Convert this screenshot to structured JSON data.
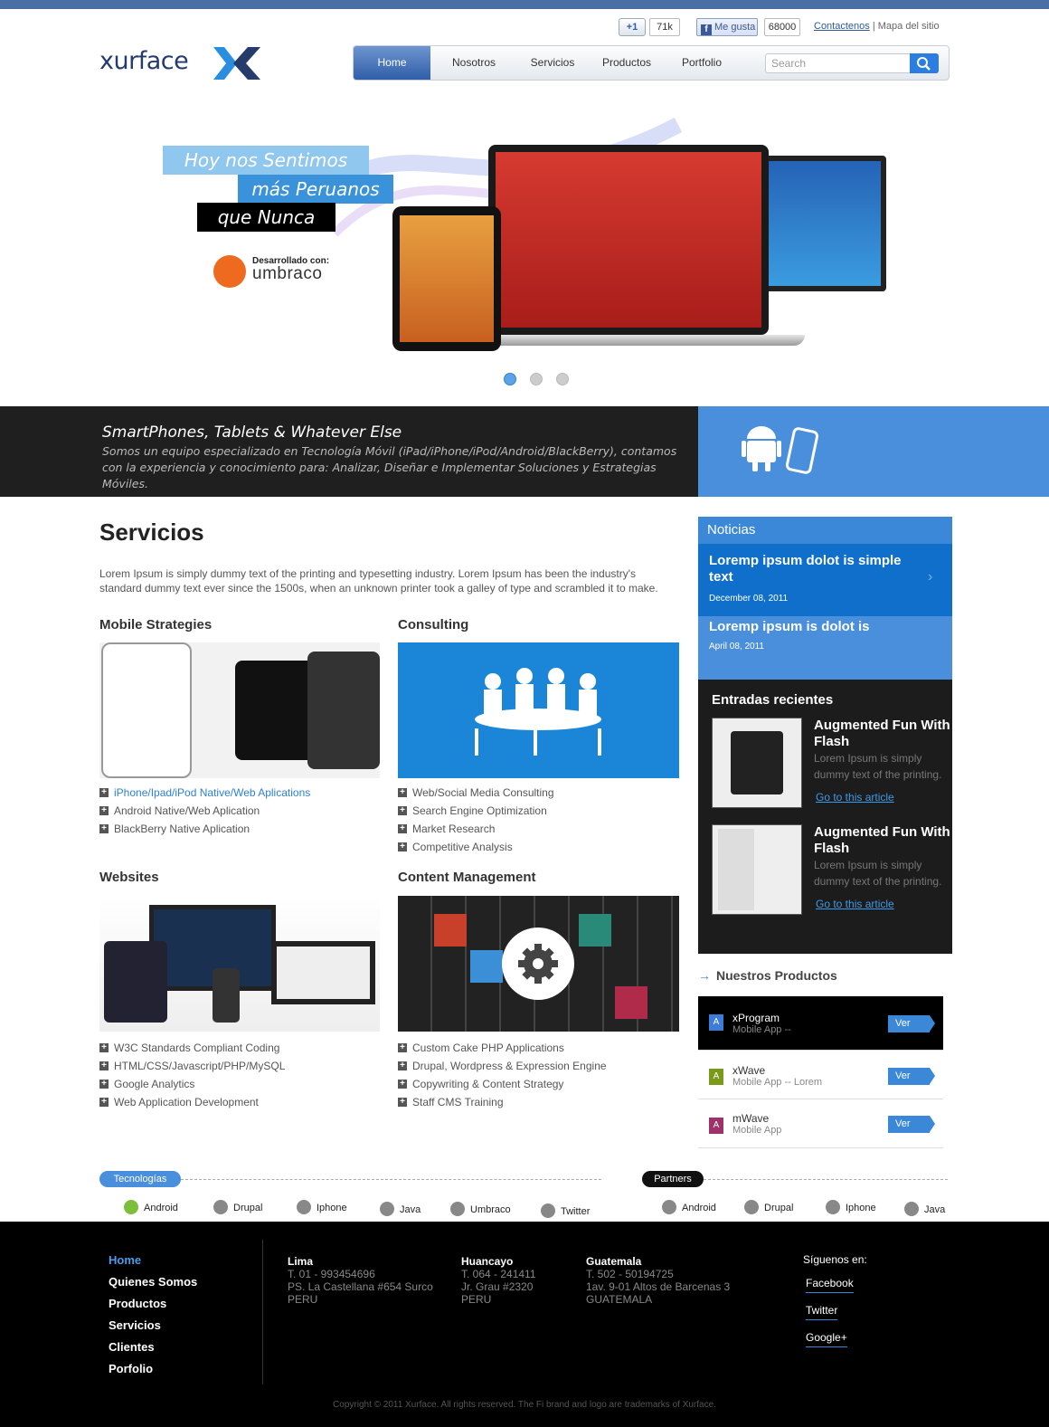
{
  "social": {
    "gplus_label": "+1",
    "gplus_count": "71k",
    "fb_label": "Me gusta",
    "fb_count": "68000",
    "contact": "Contactenos",
    "sitemap": "Mapa del sitio",
    "separator": "|"
  },
  "logo": {
    "text": "xurface"
  },
  "nav": {
    "items": [
      "Home",
      "Nosotros",
      "Servicios",
      "Productos",
      "Portfolio"
    ],
    "search_placeholder": "Search"
  },
  "hero": {
    "line1": "Hoy nos Sentimos",
    "line2": "más Peruanos",
    "line3": "que Nunca",
    "dev_label": "Desarrollado con:",
    "dev_brand": "umbraco"
  },
  "banner": {
    "title": "SmartPhones, Tablets  & Whatever Else",
    "text": "Somos un equipo especializado en Tecnología Móvil (iPad/iPhone/iPod/Android/BlackBerry),  contamos con la experiencia y conocimiento para: Analizar, Diseñar e Implementar Soluciones y Estrategias Móviles."
  },
  "services": {
    "title": "Servicios",
    "intro": "Lorem Ipsum is simply dummy text of the printing and typesetting industry. Lorem Ipsum has been the industry's standard dummy text ever since the 1500s, when an unknown printer took a galley of type and scrambled it to make.",
    "mobile": {
      "title": "Mobile Strategies",
      "items": [
        "iPhone/Ipad/iPod Native/Web Aplications",
        "Android Native/Web Aplication",
        "BlackBerry Native Aplication"
      ]
    },
    "consulting": {
      "title": "Consulting",
      "items": [
        "Web/Social Media Consulting",
        "Search Engine Optimization",
        "Market Research",
        "Competitive Analysis"
      ]
    },
    "websites": {
      "title": "Websites",
      "items": [
        "W3C Standards Compliant Coding",
        "HTML/CSS/Javascript/PHP/MySQL",
        "Google Analytics",
        "Web Application Development"
      ]
    },
    "cms": {
      "title": "Content Management",
      "items": [
        "Custom Cake PHP Applications",
        "Drupal, Wordpress & Expression Engine",
        "Copywriting & Content Strategy",
        "Staff CMS Training"
      ]
    }
  },
  "noticias": {
    "title": "Noticias",
    "items": [
      {
        "title": "Loremp ipsum dolot is simple text",
        "date": "December 08, 2011"
      },
      {
        "title": "Loremp ipsum is dolot is",
        "date": "April 08, 2011"
      }
    ]
  },
  "entradas": {
    "title": "Entradas recientes",
    "items": [
      {
        "title": "Augmented Fun With Flash",
        "text": "Lorem Ipsum is simply dummy text of the printing.",
        "link": "Go to this article"
      },
      {
        "title": "Augmented Fun With Flash",
        "text": "Lorem Ipsum is simply dummy text of the printing.",
        "link": "Go to this article"
      }
    ]
  },
  "productos": {
    "title": "Nuestros Productos",
    "items": [
      {
        "icon": "A",
        "name": "xProgram",
        "sub": "Mobile App --",
        "btn": "Ver",
        "color": "#3b7dd8"
      },
      {
        "icon": "A",
        "name": "xWave",
        "sub": "Mobile App -- Lorem",
        "btn": "Ver",
        "color": "#7a9a1a"
      },
      {
        "icon": "A",
        "name": "mWave",
        "sub": "Mobile App",
        "btn": "Ver",
        "color": "#a0306a"
      }
    ]
  },
  "tecnologias": {
    "label": "Tecnologías",
    "items": [
      "Android",
      "Drupal",
      "Iphone",
      "Java",
      "Umbraco",
      "Twitter"
    ]
  },
  "partners": {
    "label": "Partners",
    "items": [
      "Android",
      "Drupal",
      "Iphone",
      "Java"
    ]
  },
  "footer": {
    "nav": [
      "Home",
      "Quienes Somos",
      "Productos",
      "Servicios",
      "Clientes",
      "Porfolio"
    ],
    "offices": [
      {
        "city": "Lima",
        "phone": "T. 01 - 993454696",
        "addr1": "PS. La Castellana #654 Surco",
        "addr2": "PERU"
      },
      {
        "city": "Huancayo",
        "phone": "T. 064 - 241411",
        "addr1": "Jr. Grau #2320",
        "addr2": "PERU"
      },
      {
        "city": "Guatemala",
        "phone": "T. 502 - 50194725",
        "addr1": "1av. 9-01 Altos de Barcenas 3",
        "addr2": "GUATEMALA"
      }
    ],
    "follow": "Síguenos en:",
    "social": [
      "Facebook",
      "Twitter",
      "Google+"
    ],
    "copyright": "Copyright © 2011 Xurface. All rights reserved. The Fi brand and logo are trademarks of Xurface."
  }
}
